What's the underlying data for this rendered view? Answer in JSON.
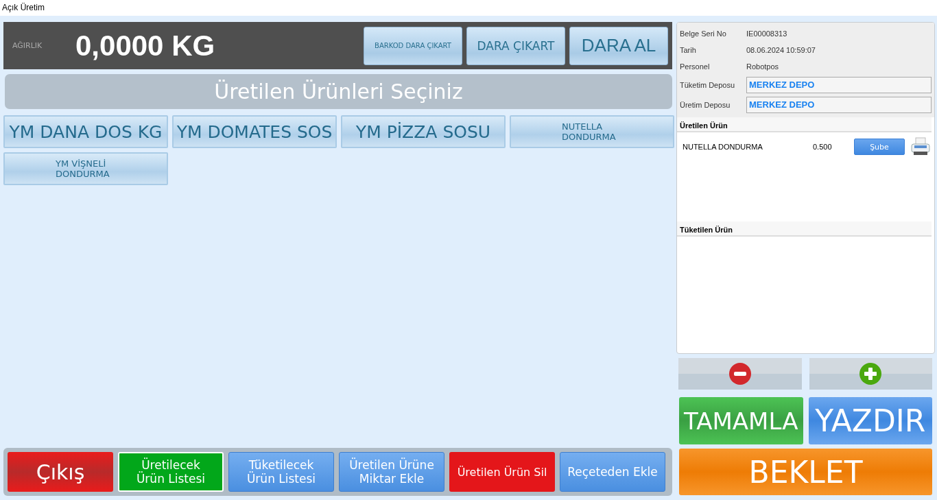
{
  "window": {
    "title": "Açık Üretim"
  },
  "scale": {
    "label": "AĞIRLIK",
    "value": "0,0000 KG",
    "buttons": [
      "BARKOD DARA ÇIKART",
      "DARA ÇIKART",
      "DARA AL"
    ]
  },
  "products_header": "Üretilen Ürünleri Seçiniz",
  "products": [
    "YM DANA DOS KG",
    "YM DOMATES SOS",
    "YM PİZZA SOSU",
    "NUTELLA\nDONDURMA",
    "YM VİŞNELİ\nDONDURMA"
  ],
  "bottom_buttons": [
    {
      "label": "Çıkış",
      "kind": "exit"
    },
    {
      "label": "Üretilecek\nÜrün Listesi",
      "kind": "success"
    },
    {
      "label": "Tüketilecek\nÜrün Listesi",
      "kind": "primary"
    },
    {
      "label": "Üretilen Ürüne\nMiktar Ekle",
      "kind": "primary"
    },
    {
      "label": "Üretilen Ürün Sil",
      "kind": "danger"
    },
    {
      "label": "Reçeteden Ekle",
      "kind": "primary"
    }
  ],
  "document": {
    "fields": [
      {
        "label": "Belge Seri No",
        "value": "IE00008313",
        "kind": "text"
      },
      {
        "label": "Tarih",
        "value": "08.06.2024 10:59:07",
        "kind": "text"
      },
      {
        "label": "Personel",
        "value": "Robotpos",
        "kind": "text"
      },
      {
        "label": "Tüketim Deposu",
        "value": "MERKEZ DEPO",
        "kind": "box"
      },
      {
        "label": "Üretim Deposu",
        "value": "MERKEZ DEPO",
        "kind": "box"
      }
    ]
  },
  "produced": {
    "title": "Üretilen Ürün",
    "rows": [
      {
        "name": "NUTELLA DONDURMA",
        "quantity": "0.500",
        "button": "Şube"
      }
    ]
  },
  "consumed": {
    "title": "Tüketilen Ürün"
  },
  "actions": {
    "complete": "TAMAMLA",
    "print": "YAZDIR",
    "hold": "BEKLET"
  }
}
